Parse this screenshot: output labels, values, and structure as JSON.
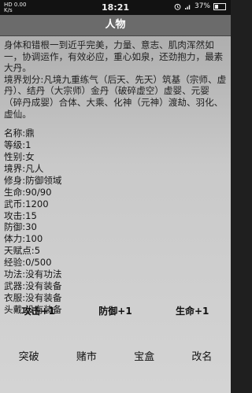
{
  "status_bar": {
    "left_text": "HD 0.00\nK/s",
    "time": "18:21",
    "battery_percent": "37%",
    "battery_level": 0.37
  },
  "title": "人物",
  "description": [
    "身体和错根一到近乎完美，力量、意志、肌肉浑然如一，协调运作，有效必应，重心如泉，还劲抱力，最素大丹。",
    "境界划分:凡境九重练气（后天、先天）筑基（宗师、虚丹）、结丹（大宗师）金丹（破碎虚空）虚婴、元婴（碎丹成婴）合体、大乘、化神（元神）渡劫、羽化、虚仙。"
  ],
  "stats": [
    "名称:鼎",
    "等级:1",
    "性别:女",
    "境界:凡人",
    "修身:防御领域",
    "生命:90/90",
    "武币:1200",
    "攻击:15",
    "防御:30",
    "体力:100",
    "天赋点:5",
    "经验:0/500",
    "功法:没有功法",
    "武器:没有装备",
    "衣服:没有装备",
    "头戴:没有装备"
  ],
  "boost_buttons": [
    "攻击+1",
    "防御+1",
    "生命+1"
  ],
  "action_buttons": [
    "突破",
    "赌市",
    "宝盒",
    "改名"
  ]
}
